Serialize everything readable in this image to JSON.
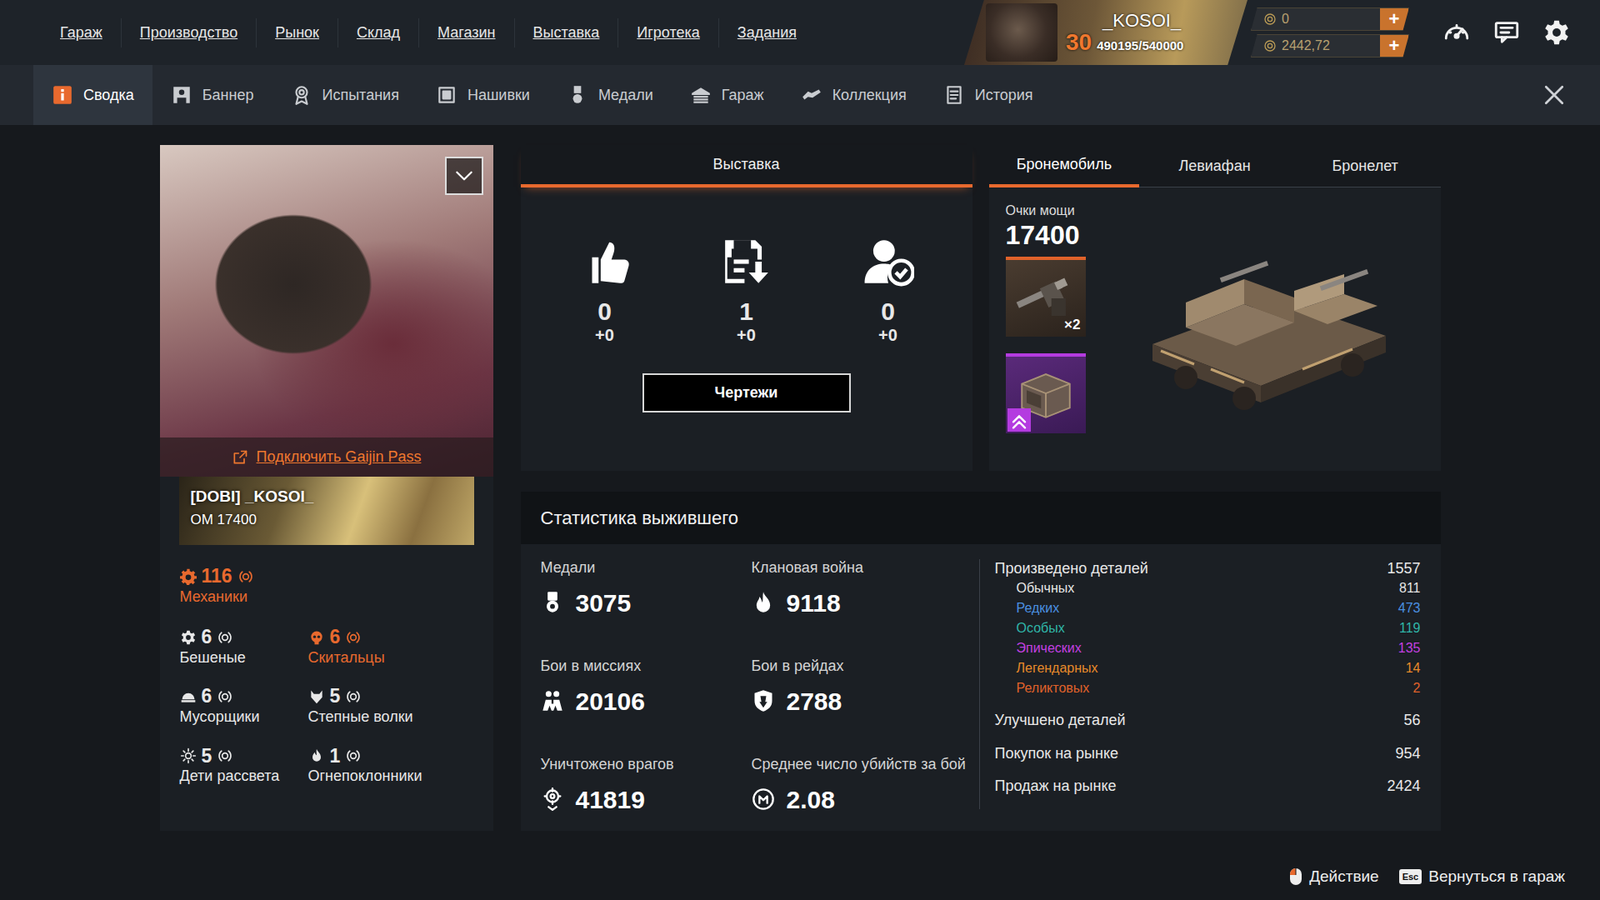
{
  "top_nav": {
    "items": [
      "Гараж",
      "Производство",
      "Рынок",
      "Склад",
      "Магазин",
      "Выставка",
      "Игротека",
      "Задания"
    ]
  },
  "player": {
    "name": "_KOSOI_",
    "level": "30",
    "xp": "490195/540000"
  },
  "currencies": [
    {
      "value": "0",
      "plus": "+"
    },
    {
      "value": "2442,72",
      "plus": "+"
    }
  ],
  "sub_tabs": [
    {
      "label": "Сводка",
      "selected": true,
      "kind": "info"
    },
    {
      "label": "Баннер",
      "selected": false,
      "kind": "banner"
    },
    {
      "label": "Испытания",
      "selected": false,
      "kind": "trials"
    },
    {
      "label": "Нашивки",
      "selected": false,
      "kind": "patches"
    },
    {
      "label": "Медали",
      "selected": false,
      "kind": "medals"
    },
    {
      "label": "Гараж",
      "selected": false,
      "kind": "garage"
    },
    {
      "label": "Коллекция",
      "selected": false,
      "kind": "collection"
    },
    {
      "label": "История",
      "selected": false,
      "kind": "history"
    }
  ],
  "profile": {
    "gaijin_link": "Подключить Gaijin Pass",
    "banner_name": "[DOBI] _KOSOI_",
    "banner_power": "ОМ 17400",
    "main_faction": {
      "value": "116",
      "label": "Механики",
      "color": "#e8692e"
    },
    "factions": [
      {
        "value": "6",
        "label": "Бешеные",
        "color": "#e8e8e8",
        "kind": "gear"
      },
      {
        "value": "6",
        "label": "Скитальцы",
        "color": "#e8692e",
        "kind": "skull"
      },
      {
        "value": "6",
        "label": "Мусорщики",
        "color": "#e8e8e8",
        "kind": "dome"
      },
      {
        "value": "5",
        "label": "Степные волки",
        "color": "#e8e8e8",
        "kind": "wolf"
      },
      {
        "value": "5",
        "label": "Дети рассвета",
        "color": "#e8e8e8",
        "kind": "sun"
      },
      {
        "value": "1",
        "label": "Огнепоклонники",
        "color": "#e8e8e8",
        "kind": "fire"
      }
    ]
  },
  "exhibition": {
    "tab": "Выставка",
    "stats": [
      {
        "kind": "likes",
        "value": "0",
        "delta": "+0"
      },
      {
        "kind": "downloads",
        "value": "1",
        "delta": "+0"
      },
      {
        "kind": "users",
        "value": "0",
        "delta": "+0"
      }
    ],
    "button": "Чертежи"
  },
  "vehicle": {
    "tabs": [
      {
        "label": "Бронемобиль",
        "selected": true
      },
      {
        "label": "Левиафан",
        "selected": false
      },
      {
        "label": "Бронелет",
        "selected": false
      }
    ],
    "power_label": "Очки мощи",
    "power": "17400",
    "parts": [
      {
        "kind": "weapon",
        "count": "×2",
        "color": "#e0622a"
      },
      {
        "kind": "cabin",
        "color": "#b43be0"
      }
    ]
  },
  "stats": {
    "title": "Статистика выжившего",
    "items": [
      {
        "label": "Медали",
        "value": "3075",
        "kind": "medal"
      },
      {
        "label": "Клановая война",
        "value": "9118",
        "kind": "flame"
      },
      {
        "label": "Бои в миссиях",
        "value": "20106",
        "kind": "mission"
      },
      {
        "label": "Бои в рейдах",
        "value": "2788",
        "kind": "raid"
      },
      {
        "label": "Уничтожено врагов",
        "value": "41819",
        "kind": "target"
      },
      {
        "label": "Среднее число убийств за бой",
        "value": "2.08",
        "kind": "kills"
      }
    ],
    "produced": {
      "label": "Произведено деталей",
      "value": "1557",
      "rarities": [
        {
          "label": "Обычных",
          "value": "811",
          "color": "#e6e6e6"
        },
        {
          "label": "Редких",
          "value": "473",
          "color": "#4a8fe0"
        },
        {
          "label": "Особых",
          "value": "119",
          "color": "#2fb5a8"
        },
        {
          "label": "Эпических",
          "value": "135",
          "color": "#c23fe0"
        },
        {
          "label": "Легендарных",
          "value": "14",
          "color": "#e88a2a"
        },
        {
          "label": "Реликтовых",
          "value": "2",
          "color": "#e0622a"
        }
      ]
    },
    "other": [
      {
        "label": "Улучшено деталей",
        "value": "56"
      },
      {
        "label": "Покупок на рынке",
        "value": "954"
      },
      {
        "label": "Продаж на рынке",
        "value": "2424"
      }
    ]
  },
  "footer": {
    "action": "Действие",
    "esc_key": "Esc",
    "back": "Вернуться в гараж"
  }
}
